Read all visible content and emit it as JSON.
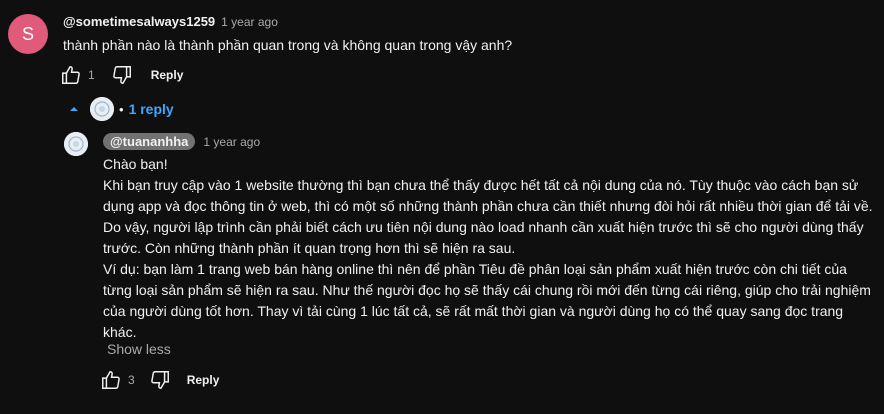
{
  "top_comment": {
    "avatar_letter": "S",
    "avatar_color": "#e05a79",
    "handle": "@sometimesalways1259",
    "time": "1 year ago",
    "text": "thành phần nào là thành phần quan trong và không quan trong vậy anh?",
    "likes": "1",
    "reply_label": "Reply"
  },
  "replies_toggle": {
    "icon": "chevron-up-icon",
    "dot": "•",
    "label": "1 reply",
    "color": "#3ea6ff"
  },
  "reply": {
    "handle": "@tuananhha",
    "time": "1 year ago",
    "lines": [
      "Chào bạn!",
      "Khi bạn truy cập vào 1 website thường thì bạn chưa thể thấy được hết tất cả nội dung của nó. Tùy thuộc vào cách bạn sử dụng app và đọc thông tin ở web, thì có một số những thành phần chưa cần thiết nhưng đòi hỏi rất nhiều thời gian để tải về. Do vậy, người lập trình cần phải biết cách ưu tiên nội dung nào load nhanh cần xuất hiện trước thì sẽ cho người dùng thấy trước. Còn những thành phần ít quan trọng hơn thì sẽ hiện ra sau.",
      "Ví dụ: bạn làm 1 trang web bán hàng online thì nên để phần Tiêu đề phân loại sản phẩm xuất hiện trước còn chi tiết của từng loại sản phẩm sẽ hiện ra sau. Như thế người đọc họ sẽ thấy cái chung rồi mới đến từng cái riêng, giúp cho trải nghiệm của người dùng tốt hơn. Thay vì tải cùng 1 lúc tất cả, sẽ rất mất thời gian và người dùng họ có thể quay sang đọc trang khác."
    ],
    "show_less": "Show less",
    "likes": "3",
    "reply_label": "Reply"
  }
}
